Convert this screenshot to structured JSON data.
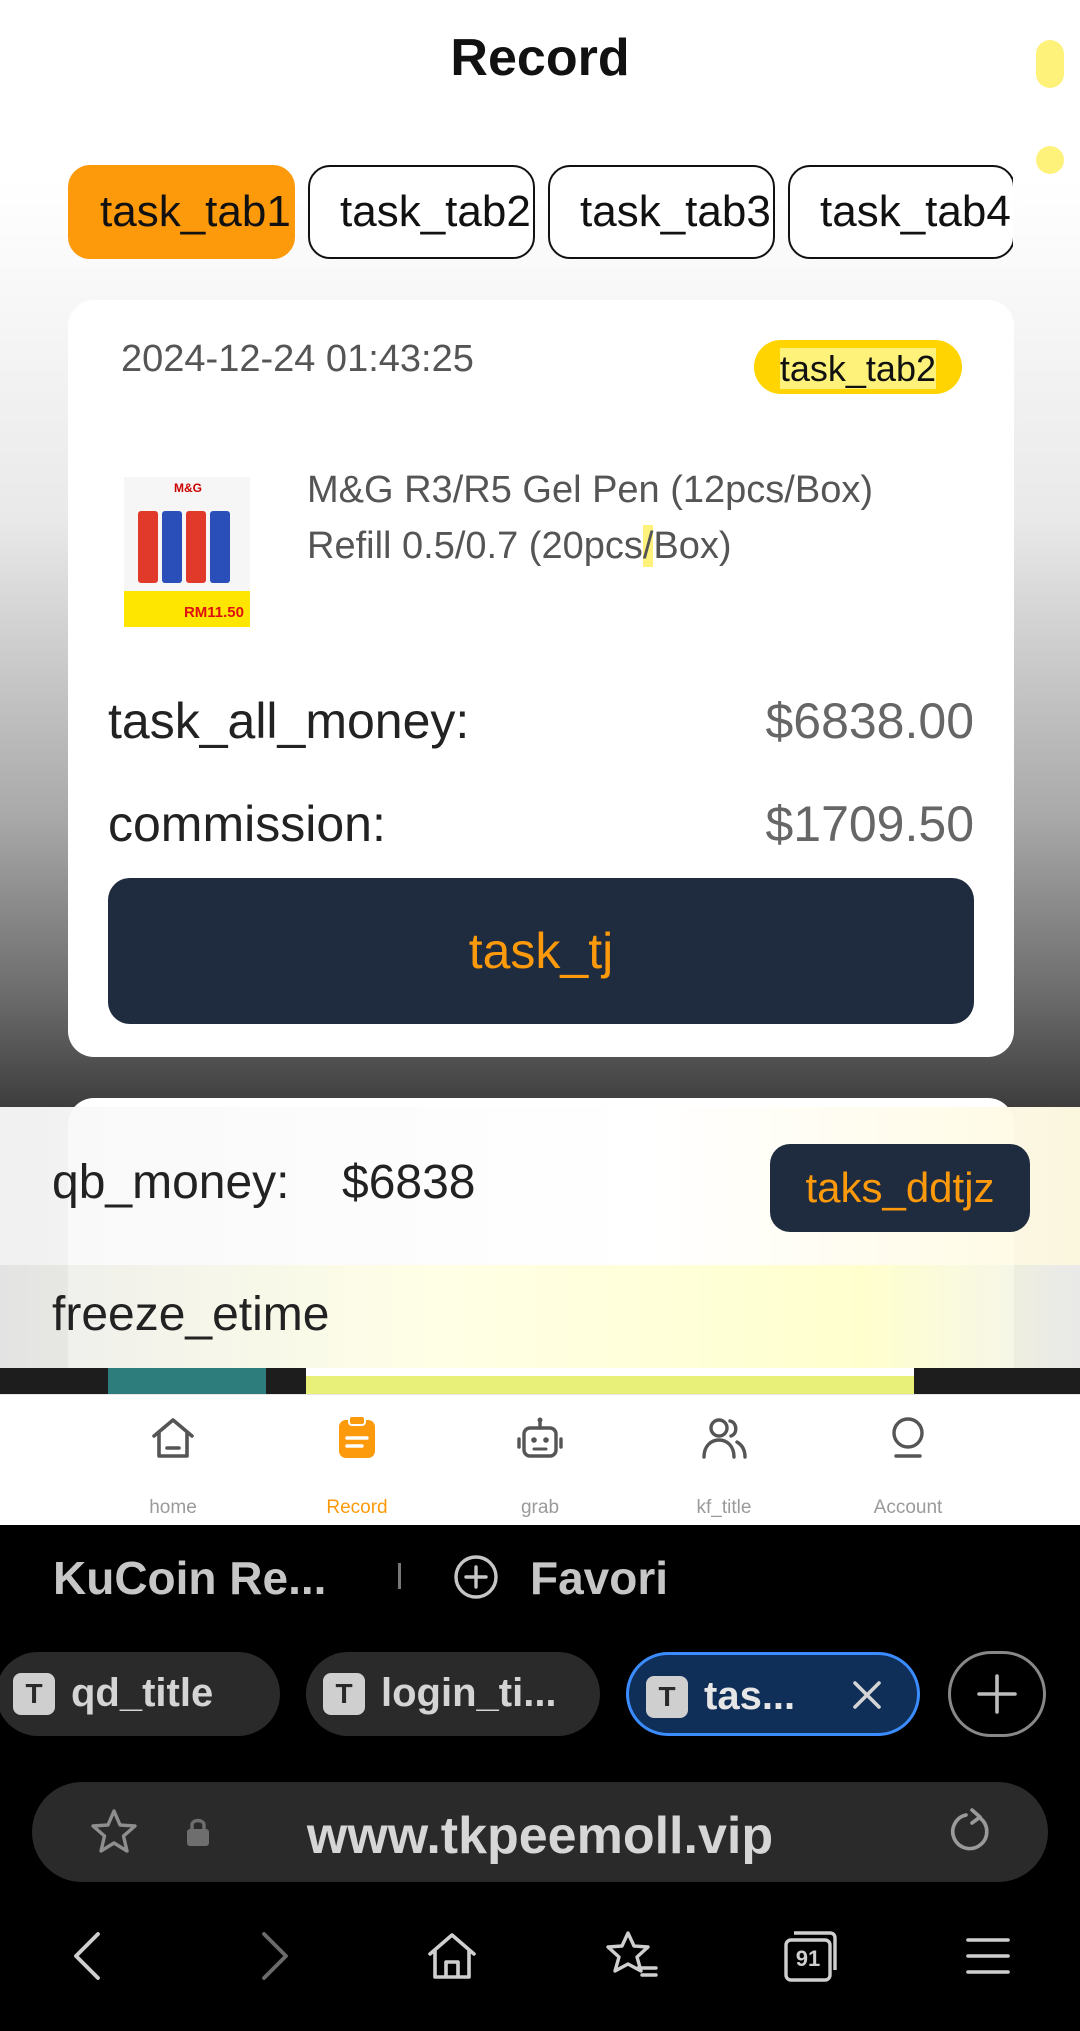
{
  "page": {
    "title": "Record",
    "tabs": [
      "task_tab1",
      "task_tab2",
      "task_tab3",
      "task_tab4"
    ],
    "active_tab": "task_tab1",
    "order": {
      "datetime": "2024-12-24 01:43:25",
      "status": "task_tab2",
      "product_name_line1": "M&G R3/R5 Gel Pen (12pcs/Box)",
      "product_name_line2_pre": "Refill 0.5/0.7 (20pcs",
      "product_name_line2_hl": "/",
      "product_name_line2_post": "Box)",
      "thumb_logo": "M&G",
      "thumb_price": "RM11.50",
      "total_label": "task_all_money:",
      "total_value": "$6838.00",
      "commission_label": "commission:",
      "commission_value": "$1709.50",
      "submit_label": "task_tj"
    },
    "summary": {
      "qb_label": "qb_money:",
      "qb_value": "$6838",
      "ddtjz_label": "taks_ddtjz",
      "freeze_label": "freeze_etime"
    },
    "nav": [
      {
        "label": "home",
        "icon": "home-icon"
      },
      {
        "label": "Record",
        "icon": "clipboard-icon"
      },
      {
        "label": "grab",
        "icon": "robot-icon"
      },
      {
        "label": "kf_title",
        "icon": "users-icon"
      },
      {
        "label": "Account",
        "icon": "account-icon"
      }
    ],
    "accent": "#fd9a0b",
    "dark": "#1f2b3e"
  },
  "browser": {
    "bookmark1": "KuCoin Re...",
    "bookmark2": "Favori",
    "tabs": [
      {
        "label": "qd_title",
        "icon_letter": "T"
      },
      {
        "label": "login_ti...",
        "icon_letter": "T"
      },
      {
        "label": "tas...",
        "icon_letter": "T"
      }
    ],
    "url": "www.tkpeemoll.vip",
    "tab_count": "91"
  }
}
